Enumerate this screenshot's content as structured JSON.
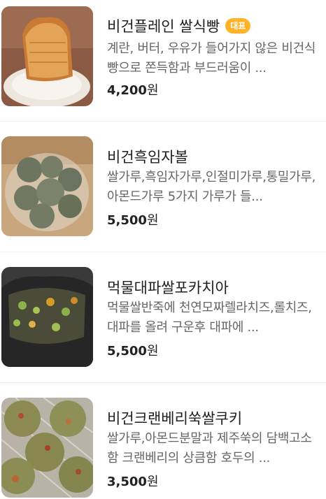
{
  "menu": {
    "items": [
      {
        "name": "비건플레인 쌀식빵",
        "badge": "대표",
        "description": "계란, 버터, 우유가 들어가지 않은 비건식빵으로 쫀득함과 부드러움이 ...",
        "price": "4,200",
        "price_unit": "원",
        "image_icon": "bread-loaf-photo"
      },
      {
        "name": "비건흑임자볼",
        "badge": "",
        "description": "쌀가루,흑임자가루,인절미가루,통밀가루,아몬드가루 5가지 가루가 들...",
        "price": "5,500",
        "price_unit": "원",
        "image_icon": "black-sesame-balls-photo"
      },
      {
        "name": "먹물대파쌀포카치아",
        "badge": "",
        "description": "먹물쌀반죽에 천연모짜렐라치즈,롤치즈,대파를 올려 구운후 대파에 ...",
        "price": "5,500",
        "price_unit": "원",
        "image_icon": "focaccia-photo"
      },
      {
        "name": "비건크랜베리쑥쌀쿠키",
        "badge": "",
        "description": "쌀가루,아몬드분말과 제주쑥의 담백고소함 크랜베리의 상큼함 호두의 ...",
        "price": "3,500",
        "price_unit": "원",
        "image_icon": "mugwort-cookies-photo"
      }
    ]
  }
}
